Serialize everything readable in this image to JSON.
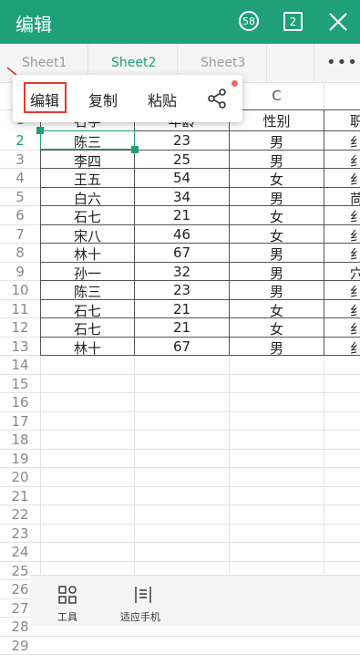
{
  "header": {
    "title": "编辑",
    "badge_circle": "58",
    "badge_square": "2"
  },
  "sheets": [
    "Sheet1",
    "Sheet2",
    "Sheet3"
  ],
  "active_sheet": "Sheet2",
  "more_label": "•••",
  "popup": {
    "edit": "编辑",
    "copy": "复制",
    "paste": "粘贴"
  },
  "columns": {
    "c": "C"
  },
  "header_row": {
    "a": "名字",
    "b": "年龄",
    "c": "性别",
    "d": "职"
  },
  "rows": [
    {
      "num": "2",
      "name": "陈三",
      "age": "23",
      "gender": "男",
      "d": "纟"
    },
    {
      "num": "3",
      "name": "李四",
      "age": "25",
      "gender": "男",
      "d": "纟"
    },
    {
      "num": "4",
      "name": "王五",
      "age": "54",
      "gender": "女",
      "d": "纟"
    },
    {
      "num": "5",
      "name": "白六",
      "age": "34",
      "gender": "男",
      "d": "苘"
    },
    {
      "num": "6",
      "name": "石七",
      "age": "21",
      "gender": "女",
      "d": "纟"
    },
    {
      "num": "7",
      "name": "宋八",
      "age": "46",
      "gender": "女",
      "d": "纟"
    },
    {
      "num": "8",
      "name": "林十",
      "age": "67",
      "gender": "男",
      "d": "纟"
    },
    {
      "num": "9",
      "name": "孙一",
      "age": "32",
      "gender": "男",
      "d": "穴"
    },
    {
      "num": "10",
      "name": "陈三",
      "age": "23",
      "gender": "男",
      "d": "纟"
    },
    {
      "num": "11",
      "name": "石七",
      "age": "21",
      "gender": "女",
      "d": "纟"
    },
    {
      "num": "12",
      "name": "石七",
      "age": "21",
      "gender": "女",
      "d": "纟"
    },
    {
      "num": "13",
      "name": "林十",
      "age": "67",
      "gender": "男",
      "d": "纟"
    }
  ],
  "row_header_top": "1",
  "empty_rows": [
    "14",
    "15",
    "16",
    "17",
    "18",
    "19",
    "20",
    "21",
    "22",
    "23",
    "24",
    "25",
    "26",
    "27",
    "28",
    "29"
  ],
  "bottom": {
    "tools": "工具",
    "fit": "适应手机"
  },
  "colors": {
    "accent": "#1fa07a",
    "highlight": "#e0392f"
  }
}
